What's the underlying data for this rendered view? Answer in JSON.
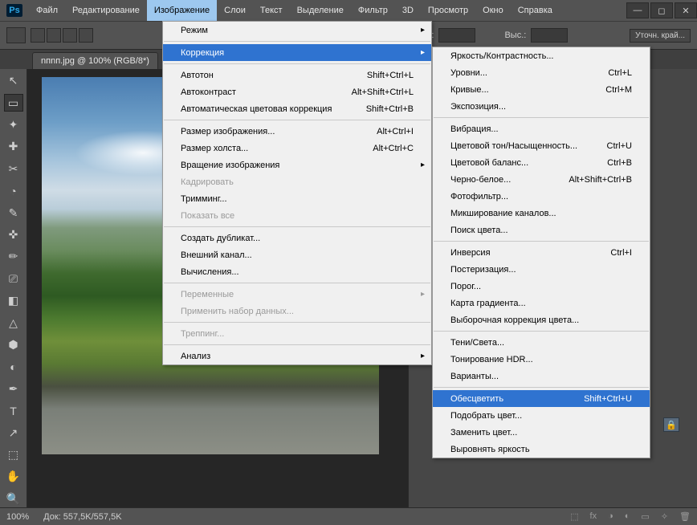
{
  "app": {
    "logo": "Ps"
  },
  "menus": [
    "Файл",
    "Редактирование",
    "Изображение",
    "Слои",
    "Текст",
    "Выделение",
    "Фильтр",
    "3D",
    "Просмотр",
    "Окно",
    "Справка"
  ],
  "active_menu_index": 2,
  "window_buttons": {
    "min": "—",
    "max": "◻",
    "close": "✕"
  },
  "options_bar": {
    "width_label": "Шир.:",
    "height_label": "Выс.:",
    "refine_edges": "Уточн. край..."
  },
  "document_tab": "nпnп.jpg @ 100% (RGB/8*)",
  "tools": [
    "↖",
    "▭",
    "✦",
    "✚",
    "✂",
    "◔",
    "✎",
    "✜",
    "✏",
    "⎚",
    "◧",
    "△",
    "⬢",
    "◐",
    "✒",
    "T",
    "↗",
    "⬚",
    "✋",
    "🔍"
  ],
  "status": {
    "zoom": "100%",
    "doc": "Док: 557,5K/557,5K"
  },
  "image_menu": [
    {
      "t": "row",
      "label": "Режим",
      "sub": true
    },
    {
      "t": "sep"
    },
    {
      "t": "row",
      "label": "Коррекция",
      "sub": true,
      "hl": true
    },
    {
      "t": "sep"
    },
    {
      "t": "row",
      "label": "Автотон",
      "sc": "Shift+Ctrl+L"
    },
    {
      "t": "row",
      "label": "Автоконтраст",
      "sc": "Alt+Shift+Ctrl+L"
    },
    {
      "t": "row",
      "label": "Автоматическая цветовая коррекция",
      "sc": "Shift+Ctrl+B"
    },
    {
      "t": "sep"
    },
    {
      "t": "row",
      "label": "Размер изображения...",
      "sc": "Alt+Ctrl+I"
    },
    {
      "t": "row",
      "label": "Размер холста...",
      "sc": "Alt+Ctrl+C"
    },
    {
      "t": "row",
      "label": "Вращение изображения",
      "sub": true
    },
    {
      "t": "row",
      "label": "Кадрировать",
      "dis": true
    },
    {
      "t": "row",
      "label": "Тримминг..."
    },
    {
      "t": "row",
      "label": "Показать все",
      "dis": true
    },
    {
      "t": "sep"
    },
    {
      "t": "row",
      "label": "Создать дубликат..."
    },
    {
      "t": "row",
      "label": "Внешний канал..."
    },
    {
      "t": "row",
      "label": "Вычисления..."
    },
    {
      "t": "sep"
    },
    {
      "t": "row",
      "label": "Переменные",
      "sub": true,
      "dis": true
    },
    {
      "t": "row",
      "label": "Применить набор данных...",
      "dis": true
    },
    {
      "t": "sep"
    },
    {
      "t": "row",
      "label": "Треппинг...",
      "dis": true
    },
    {
      "t": "sep"
    },
    {
      "t": "row",
      "label": "Анализ",
      "sub": true
    }
  ],
  "adjust_menu": [
    {
      "t": "row",
      "label": "Яркость/Контрастность..."
    },
    {
      "t": "row",
      "label": "Уровни...",
      "sc": "Ctrl+L"
    },
    {
      "t": "row",
      "label": "Кривые...",
      "sc": "Ctrl+M"
    },
    {
      "t": "row",
      "label": "Экспозиция..."
    },
    {
      "t": "sep"
    },
    {
      "t": "row",
      "label": "Вибрация..."
    },
    {
      "t": "row",
      "label": "Цветовой тон/Насыщенность...",
      "sc": "Ctrl+U"
    },
    {
      "t": "row",
      "label": "Цветовой баланс...",
      "sc": "Ctrl+B"
    },
    {
      "t": "row",
      "label": "Черно-белое...",
      "sc": "Alt+Shift+Ctrl+B"
    },
    {
      "t": "row",
      "label": "Фотофильтр..."
    },
    {
      "t": "row",
      "label": "Микширование каналов..."
    },
    {
      "t": "row",
      "label": "Поиск цвета..."
    },
    {
      "t": "sep"
    },
    {
      "t": "row",
      "label": "Инверсия",
      "sc": "Ctrl+I"
    },
    {
      "t": "row",
      "label": "Постеризация..."
    },
    {
      "t": "row",
      "label": "Порог..."
    },
    {
      "t": "row",
      "label": "Карта градиента..."
    },
    {
      "t": "row",
      "label": "Выборочная коррекция цвета..."
    },
    {
      "t": "sep"
    },
    {
      "t": "row",
      "label": "Тени/Света..."
    },
    {
      "t": "row",
      "label": "Тонирование HDR..."
    },
    {
      "t": "row",
      "label": "Варианты..."
    },
    {
      "t": "sep"
    },
    {
      "t": "row",
      "label": "Обесцветить",
      "sc": "Shift+Ctrl+U",
      "hl": true
    },
    {
      "t": "row",
      "label": "Подобрать цвет..."
    },
    {
      "t": "row",
      "label": "Заменить цвет..."
    },
    {
      "t": "row",
      "label": "Выровнять яркость"
    }
  ],
  "right_icons": [
    "⬚",
    "fx",
    "◑",
    "◐",
    "▭",
    "✧",
    "🗑"
  ]
}
